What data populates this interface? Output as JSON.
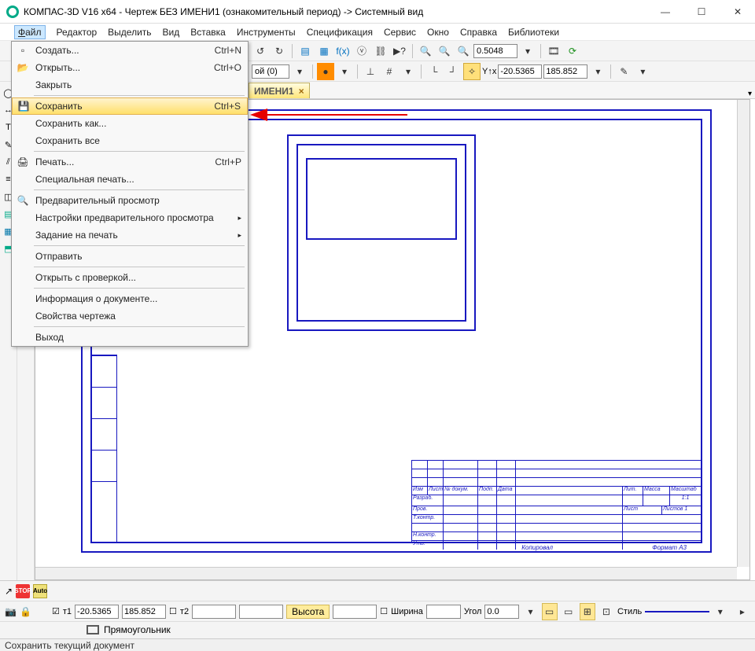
{
  "titlebar": {
    "text": "КОМПАС-3D V16  x64 - Чертеж БЕЗ ИМЕНИ1 (ознакомительный период) -> Системный вид"
  },
  "menubar": {
    "file": "Файл",
    "editor": "Редактор",
    "select": "Выделить",
    "view": "Вид",
    "insert": "Вставка",
    "tools": "Инструменты",
    "spec": "Спецификация",
    "service": "Сервис",
    "window": "Окно",
    "help": "Справка",
    "libs": "Библиотеки"
  },
  "file_menu": {
    "create": "Создать...",
    "create_sc": "Ctrl+N",
    "open": "Открыть...",
    "open_sc": "Ctrl+O",
    "close": "Закрыть",
    "save": "Сохранить",
    "save_sc": "Ctrl+S",
    "save_as": "Сохранить как...",
    "save_all": "Сохранить все",
    "print": "Печать...",
    "print_sc": "Ctrl+P",
    "special_print": "Специальная печать...",
    "preview": "Предварительный просмотр",
    "preview_settings": "Настройки предварительного просмотра",
    "print_job": "Задание на печать",
    "send": "Отправить",
    "open_check": "Открыть с проверкой...",
    "doc_info": "Информация о документе...",
    "drawing_props": "Свойства чертежа",
    "exit": "Выход"
  },
  "tab": {
    "label": "ИМЕНИ1"
  },
  "zoom": "0.5048",
  "coords": {
    "x": "-20.5365",
    "y": "185.852"
  },
  "layer_combo": "ой (0)",
  "bottom": {
    "t1": "т1",
    "t2": "т2",
    "t1x": "-20.5365",
    "t1y": "185.852",
    "height_lab": "Высота",
    "width_lab": "Ширина",
    "angle_lab": "Угол",
    "angle_val": "0.0",
    "style_lab": "Стиль",
    "shape_label": "Прямоугольник"
  },
  "statusbar": {
    "text": "Сохранить текущий документ"
  },
  "title_block": {
    "izm": "Изм",
    "list": "Лист",
    "ndoc": "№ докум.",
    "podp": "Подп.",
    "data": "Дата",
    "razrab": "Разраб.",
    "prov": "Пров.",
    "tkontr": "Т.контр.",
    "nkontr": "Н.контр.",
    "utv": "Утв.",
    "lit": "Лит.",
    "massa": "Масса",
    "masht": "Масштаб",
    "one": "1:1",
    "list2": "Лист",
    "listov": "Листов   1",
    "kopiroval": "Копировал",
    "format": "Формат    А3"
  }
}
